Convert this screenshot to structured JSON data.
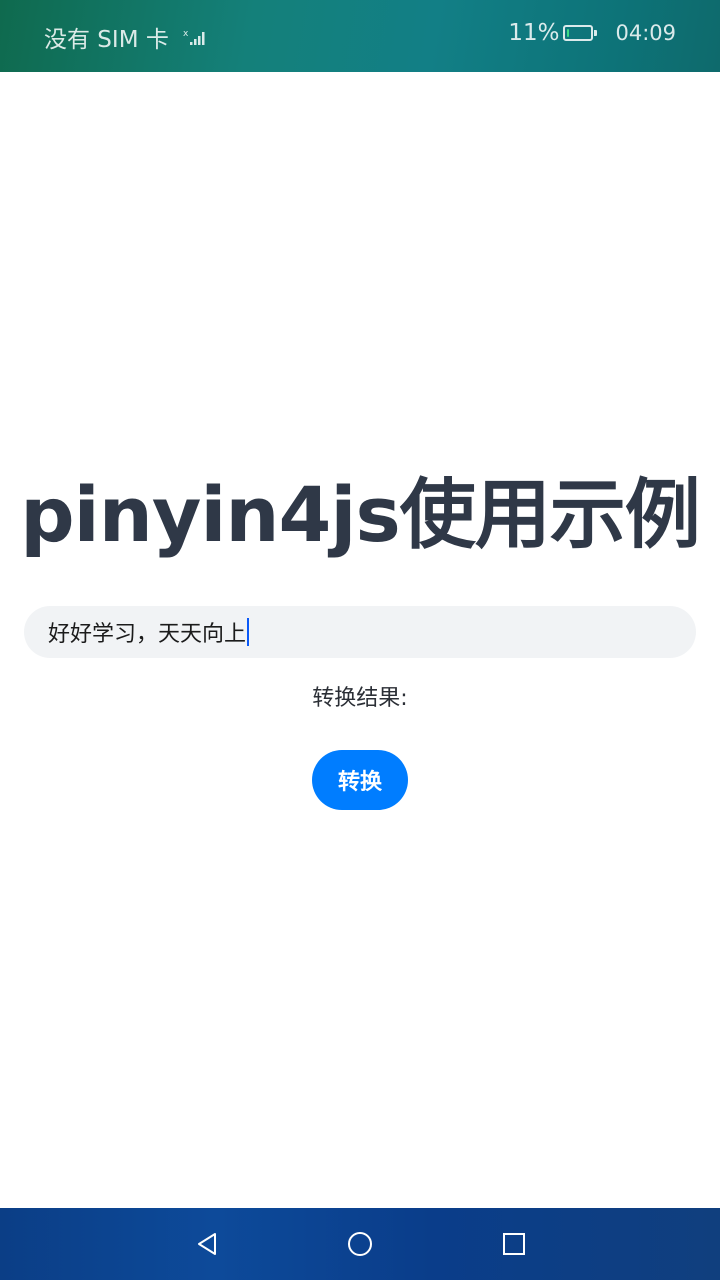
{
  "status_bar": {
    "carrier": "没有 SIM 卡",
    "signal_icon": "signal-strength-icon",
    "battery_percent": "11%",
    "battery_level": 0.11,
    "battery_fill_color": "#3ddc84",
    "time": "04:09"
  },
  "main": {
    "title": "pinyin4js使用示例",
    "input_value": "好好学习，天天向上",
    "result_label": "转换结果:",
    "convert_button_label": "转换"
  },
  "nav_bar": {
    "back_icon": "back-triangle-icon",
    "home_icon": "home-circle-icon",
    "recents_icon": "recents-square-icon"
  },
  "colors": {
    "accent": "#007dff",
    "title": "#2f3847",
    "input_bg": "#f1f3f5"
  }
}
